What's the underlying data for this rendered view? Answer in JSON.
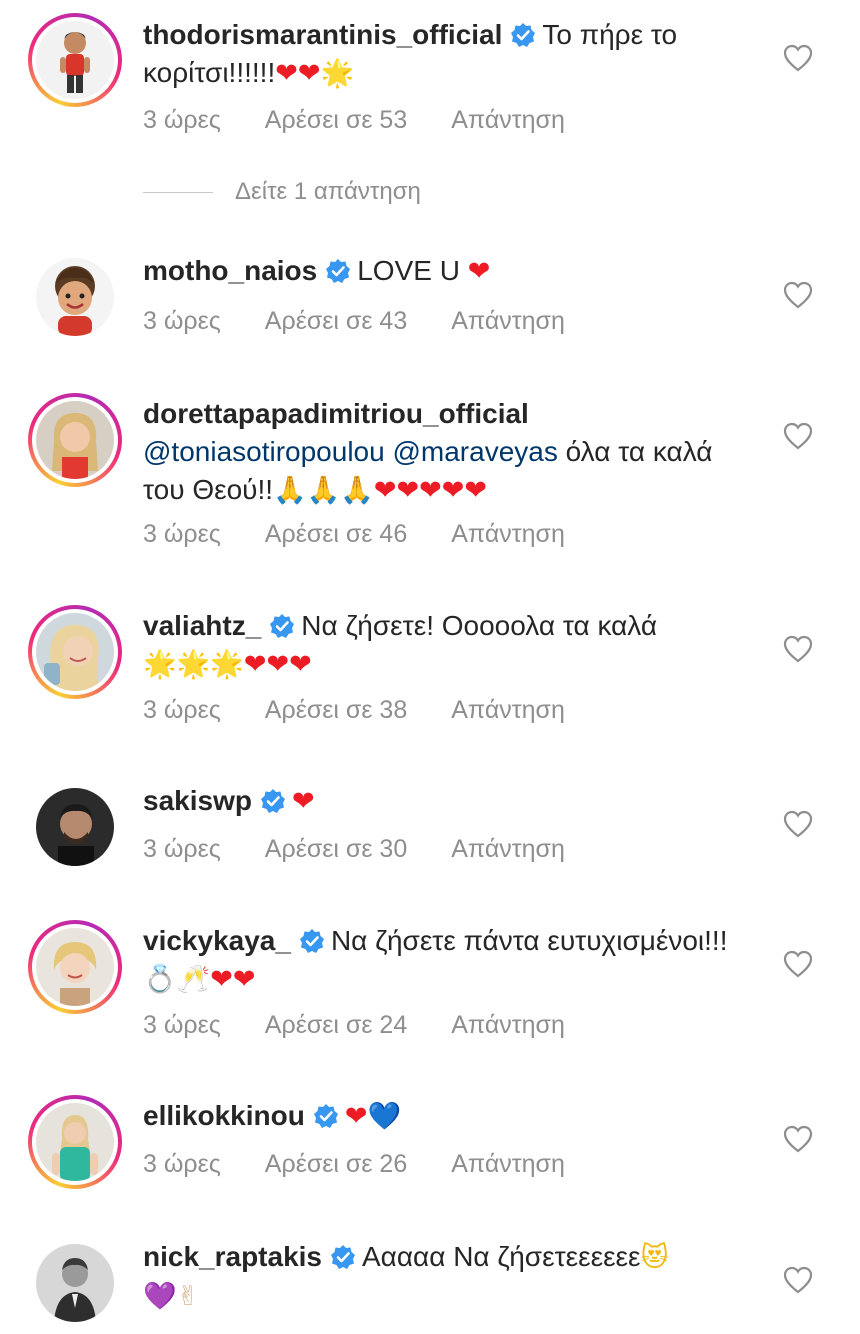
{
  "comments": [
    {
      "username": "thodorismarantinis_official",
      "verified": true,
      "text": "Το πήρε το κορίτσι!!!!!!",
      "emoji": "❤❤🌟",
      "time": "3 ώρες",
      "likes": "Αρέσει σε 53",
      "reply": "Απάντηση",
      "view_replies": "Δείτε 1 απάντηση"
    },
    {
      "username": "motho_naios",
      "verified": true,
      "text": "LOVE U",
      "emoji": "❤",
      "time": "3 ώρες",
      "likes": "Αρέσει σε 43",
      "reply": "Απάντηση"
    },
    {
      "username": "dorettapapadimitriou_official",
      "verified": false,
      "mention1": "@toniasotiropoulou",
      "mention2": "@maraveyas",
      "text": "όλα τα καλά του Θεού!!",
      "emoji_hands": "🙏🙏🙏",
      "emoji": "❤❤❤❤❤",
      "time": "3 ώρες",
      "likes": "Αρέσει σε 46",
      "reply": "Απάντηση"
    },
    {
      "username": "valiahtz_",
      "verified": true,
      "text": "Να ζήσετε! Οοοοολα τα καλά",
      "emoji_stars": "🌟🌟🌟",
      "emoji": "❤❤❤",
      "time": "3 ώρες",
      "likes": "Αρέσει σε 38",
      "reply": "Απάντηση"
    },
    {
      "username": "sakiswp",
      "verified": true,
      "text": "",
      "emoji": "❤",
      "time": "3 ώρες",
      "likes": "Αρέσει σε 30",
      "reply": "Απάντηση"
    },
    {
      "username": "vickykaya_",
      "verified": true,
      "text": "Να ζήσετε πάντα ευτυχισμένοι!!!",
      "emoji_misc": "💍🥂",
      "emoji": "❤❤",
      "time": "3 ώρες",
      "likes": "Αρέσει σε 24",
      "reply": "Απάντηση"
    },
    {
      "username": "ellikokkinou",
      "verified": true,
      "text": "",
      "emoji": "❤",
      "emoji_blue": "💙",
      "time": "3 ώρες",
      "likes": "Αρέσει σε 26",
      "reply": "Απάντηση"
    },
    {
      "username": "nick_raptakis",
      "verified": true,
      "text": "Ααααα Να ζήσετεεεεεε",
      "emoji_face": "😻",
      "emoji_purple": "💜",
      "emoji_victory": "✌",
      "time": "",
      "likes": "",
      "reply": ""
    }
  ],
  "colors": {
    "verified_badge": "#3897f0",
    "meta_text": "#8e8e8e",
    "mention": "#00376b",
    "heart_emoji": "#ed1c24"
  },
  "icons": {
    "verified": "verified-badge-icon",
    "like": "heart-outline-icon"
  }
}
